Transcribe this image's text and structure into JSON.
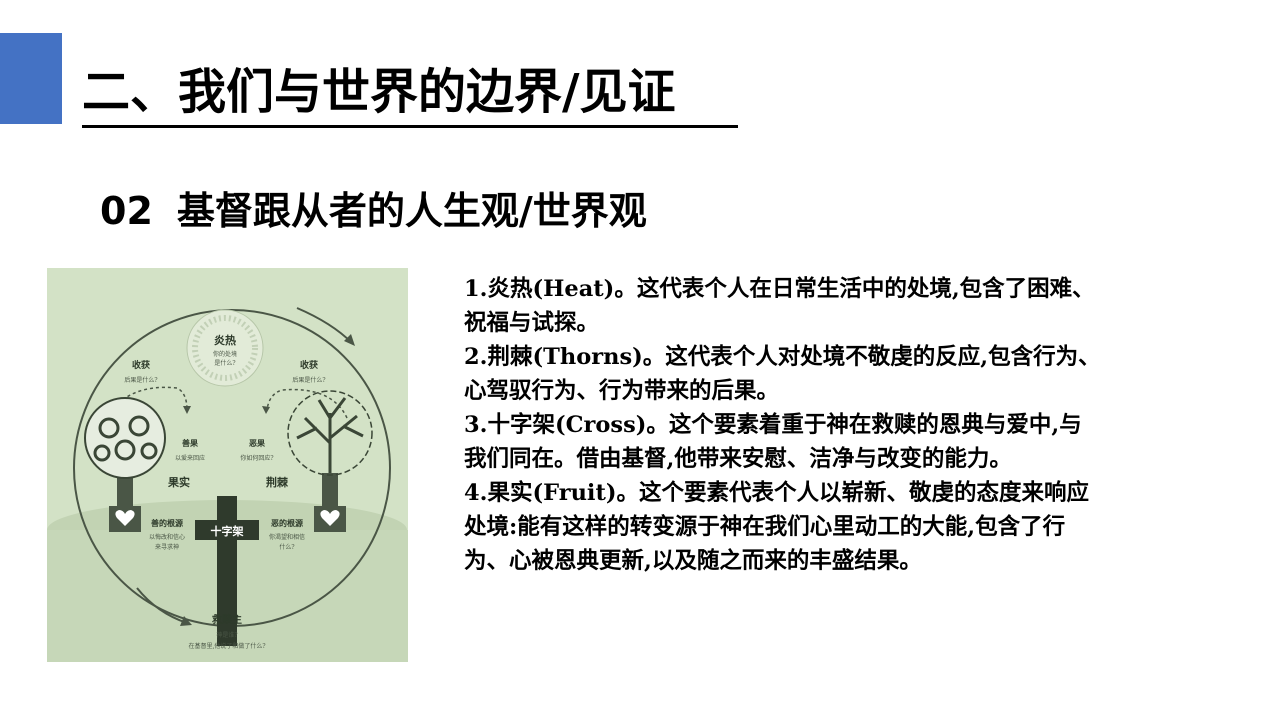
{
  "slide": {
    "accent_color": "#4472c4",
    "title": "二、我们与世界的边界/见证",
    "subtitle_number": "02",
    "subtitle_text": "基督跟从者的人生观/世界观"
  },
  "diagram": {
    "background": "#d3e2c6",
    "heat": {
      "label": "炎热",
      "q1": "你的处境",
      "q2": "是什么?"
    },
    "harvest_left": {
      "label": "收获",
      "q": "后果是什么?"
    },
    "harvest_right": {
      "label": "收获",
      "q": "后果是什么?"
    },
    "good_fruit": {
      "label": "善果",
      "q": "以爱来回应"
    },
    "bad_fruit": {
      "label": "恶果",
      "q": "你如何回应?"
    },
    "fruit_label": "果实",
    "thorns_label": "荆棘",
    "cross_label": "十字架",
    "good_root": {
      "label": "善的根源",
      "q1": "以悔改和信心",
      "q2": "来寻求神"
    },
    "bad_root": {
      "label": "恶的根源",
      "q1": "你渴望和相信",
      "q2": "什么?"
    },
    "redeemer": {
      "label": "救赎主",
      "q1": "神是谁?",
      "q2": "在基督里,他说了和做了什么?"
    }
  },
  "content": {
    "paragraphs": [
      "1.炎热(Heat)。这代表个人在日常生活中的处境,包含了困难、祝福与试探。",
      "2.荆棘(Thorns)。这代表个人对处境不敬虔的反应,包含行为、心驾驭行为、行为带来的后果。",
      "3.十字架(Cross)。这个要素着重于神在救赎的恩典与爱中,与我们同在。借由基督,他带来安慰、洁净与改变的能力。",
      "4.果实(Fruit)。这个要素代表个人以崭新、敬虔的态度来响应处境:能有这样的转变源于神在我们心里动工的大能,包含了行为、心被恩典更新,以及随之而来的丰盛结果。"
    ]
  }
}
